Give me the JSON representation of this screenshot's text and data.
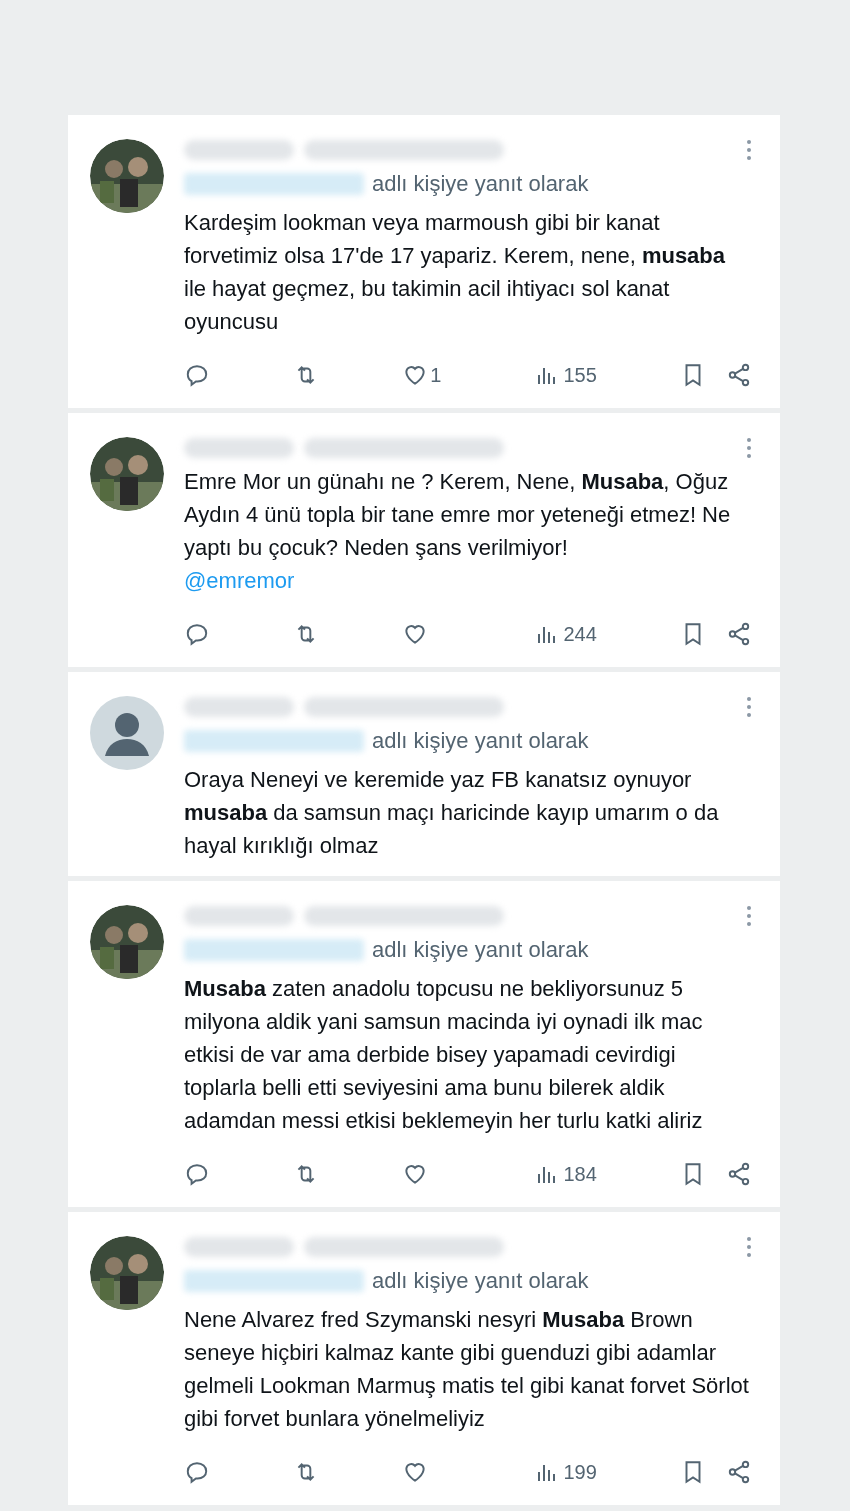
{
  "posts": [
    {
      "reply_to_label": "adlı kişiye yanıt olarak",
      "text": "Kardeşim lookman veya marmoush gibi bir kanat forvetimiz olsa 17'de 17 yapariz. Kerem, nene, **musaba** ile hayat geçmez, bu takimin acil ihtiyacı sol kanat oyuncusu",
      "actions": {
        "likes": "1",
        "views": "155"
      }
    },
    {
      "text": "Emre Mor un günahı ne ? Kerem, Nene, **Musaba**, Oğuz Aydın 4 ünü topla bir tane emre mor yeteneği etmez! Ne yaptı bu çocuk? Neden şans verilmiyor!",
      "mention": "@emremor",
      "actions": {
        "views": "244"
      }
    },
    {
      "avatar": {
        "kind": "default"
      },
      "reply_to_label": "adlı kişiye yanıt olarak",
      "text": "Oraya Neneyi ve keremide yaz FB kanatsız oynuyor **musaba** da samsun maçı haricinde kayıp umarım o da hayal kırıklığı olmaz"
    },
    {
      "reply_to_label": "adlı kişiye yanıt olarak",
      "text": "**Musaba** zaten anadolu topcusu ne bekliyorsunuz 5 milyona aldik yani samsun macinda iyi oynadi ilk mac etkisi de var ama derbide bisey yapamadi cevirdigi toplarla belli etti seviyesini ama bunu bilerek aldik adamdan messi etkisi beklemeyin her turlu katki aliriz",
      "actions": {
        "views": "184"
      }
    },
    {
      "reply_to_label": "adlı kişiye yanıt olarak",
      "text": "Nene Alvarez fred Szymanski nesyri **Musaba** Brown seneye hiçbiri kalmaz kante gibi guenduzi gibi adamlar gelmeli Lookman Marmuş matis tel gibi kanat forvet Sörlot gibi forvet bunlara yönelmeliyiz",
      "actions": {
        "views": "199"
      }
    }
  ]
}
